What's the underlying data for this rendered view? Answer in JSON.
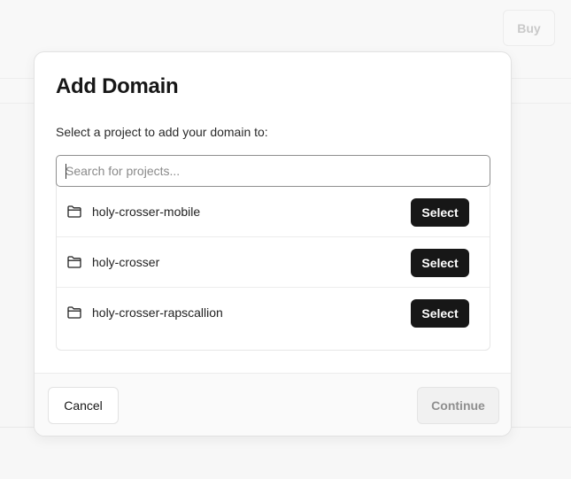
{
  "background": {
    "buy_label": "Buy"
  },
  "modal": {
    "title": "Add Domain",
    "description": "Select a project to add your domain to:",
    "search": {
      "placeholder": "Search for projects...",
      "value": ""
    },
    "projects": [
      {
        "name": "holy-crosser-mobile",
        "icon": "folder-icon",
        "action_label": "Select"
      },
      {
        "name": "holy-crosser",
        "icon": "folder-icon",
        "action_label": "Select"
      },
      {
        "name": "holy-crosser-rapscallion",
        "icon": "folder-icon",
        "action_label": "Select"
      }
    ],
    "footer": {
      "cancel_label": "Cancel",
      "continue_label": "Continue",
      "continue_disabled": true
    }
  },
  "colors": {
    "primary_button": "#171717",
    "disabled_text": "#8f8f8f"
  }
}
